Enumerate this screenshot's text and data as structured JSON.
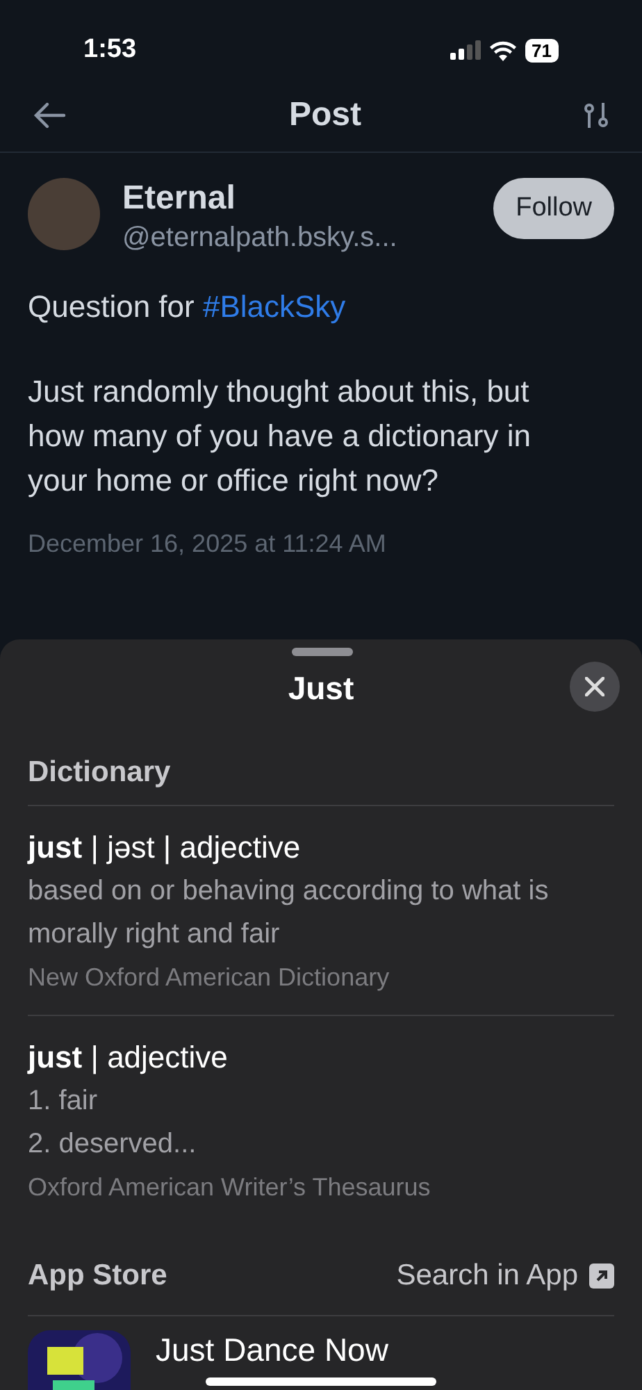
{
  "status_bar": {
    "time": "1:53",
    "battery": "71"
  },
  "header": {
    "title": "Post"
  },
  "post": {
    "author": "Eternal",
    "handle": "@eternalpath.bsky.s...",
    "follow": "Follow",
    "lead": "Question for ",
    "hashtag": "#BlackSky",
    "body": "Just randomly thought about this, but how many of you have a dictionary in your home or office right now?",
    "timestamp": "December 16, 2025 at 11:24 AM"
  },
  "sheet": {
    "title": "Just",
    "section": "Dictionary",
    "entries": [
      {
        "headline": "**just** | jəst | adjective",
        "lines": [
          "based on or behaving according to what is morally right and fair"
        ],
        "source": "New Oxford American Dictionary"
      },
      {
        "headline": "**just** | adjective",
        "lines": [
          "1. fair",
          "2. deserved..."
        ],
        "source": "Oxford American Writer’s Thesaurus"
      }
    ],
    "app_store": {
      "label": "App Store",
      "action": "Search in App",
      "app_name": "Just Dance Now"
    }
  }
}
